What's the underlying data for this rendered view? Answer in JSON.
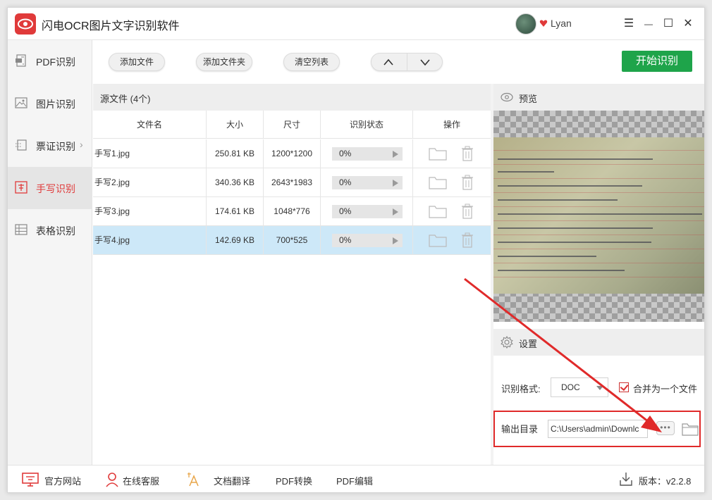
{
  "app": {
    "title": "闪电OCR图片文字识别软件",
    "user": "Lyan"
  },
  "window_controls": {
    "menu": "☰",
    "minimize": "—",
    "maximize": "☐",
    "close": "✕"
  },
  "sidebar": {
    "items": [
      {
        "label": "PDF识别",
        "icon": "pdf-icon"
      },
      {
        "label": "图片识别",
        "icon": "image-icon"
      },
      {
        "label": "票证识别",
        "icon": "ticket-icon",
        "has_submenu": true
      },
      {
        "label": "手写识别",
        "icon": "handwriting-icon",
        "active": true
      },
      {
        "label": "表格识别",
        "icon": "table-icon"
      }
    ],
    "submenu_glyph": "›"
  },
  "toolbar": {
    "add_file": "添加文件",
    "add_folder": "添加文件夹",
    "clear_list": "清空列表",
    "move_up": "∧",
    "move_down": "∨",
    "start": "开始识别"
  },
  "file_list": {
    "title": "源文件 (4个)",
    "columns": [
      "文件名",
      "大小",
      "尺寸",
      "识别状态",
      "操作"
    ],
    "rows": [
      {
        "name": "手写1.jpg",
        "size": "250.81 KB",
        "dimensions": "1200*1200",
        "status": "0%"
      },
      {
        "name": "手写2.jpg",
        "size": "340.36 KB",
        "dimensions": "2643*1983",
        "status": "0%"
      },
      {
        "name": "手写3.jpg",
        "size": "174.61 KB",
        "dimensions": "1048*776",
        "status": "0%"
      },
      {
        "name": "手写4.jpg",
        "size": "142.69 KB",
        "dimensions": "700*525",
        "status": "0%",
        "selected": true
      }
    ]
  },
  "preview": {
    "title": "预览"
  },
  "settings": {
    "title": "设置",
    "format_label": "识别格式:",
    "format_value": "DOC",
    "merge_label": "合并为一个文件",
    "merge_checked": true,
    "output_label": "输出目录",
    "output_path": "C:\\Users\\admin\\Downlc",
    "browse": "•••"
  },
  "footer": {
    "website": "官方网站",
    "support": "在线客服",
    "translate": "文档翻译",
    "pdf_convert": "PDF转换",
    "pdf_edit": "PDF编辑",
    "version": "版本：v2.2.8"
  },
  "colors": {
    "accent": "#e03a3a",
    "start_button": "#1ea44a",
    "selected_row": "#cde8f8",
    "highlight_box": "#e02a2a"
  }
}
